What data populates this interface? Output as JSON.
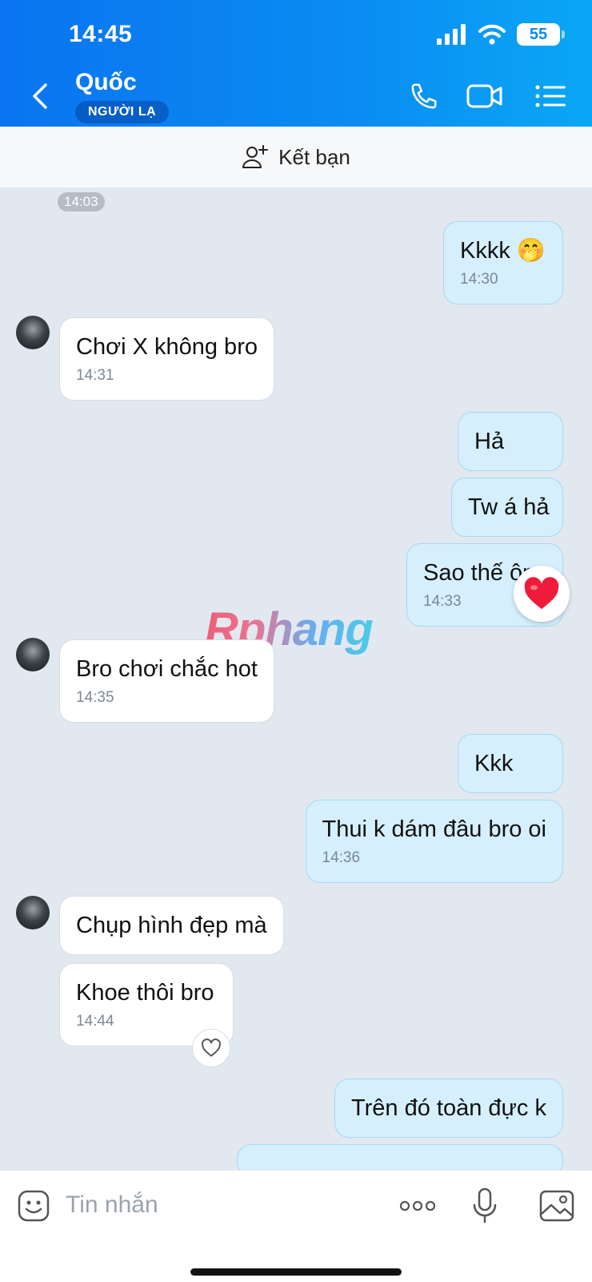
{
  "status_bar": {
    "time": "14:45",
    "battery": "55"
  },
  "header": {
    "contact_name": "Quốc",
    "badge": "NGƯỜI LẠ",
    "icons": [
      "back-icon",
      "phone-icon",
      "video-icon",
      "menu-icon"
    ]
  },
  "friend_bar": {
    "label": "Kết bạn",
    "icon": "add-friend-icon"
  },
  "chat": {
    "top_time": "14:03",
    "messages": [
      {
        "dir": "out",
        "text": "Kkkk 🤭",
        "time": "14:30"
      },
      {
        "dir": "in",
        "text": "Chơi X không bro",
        "time": "14:31"
      },
      {
        "dir": "out",
        "text": "Hả",
        "time": ""
      },
      {
        "dir": "out",
        "text": "Tw á hả",
        "time": ""
      },
      {
        "dir": "out",
        "text": "Sao thế ông",
        "time": "14:33",
        "reaction": "❤️"
      },
      {
        "dir": "in",
        "text": "Bro chơi chắc hot",
        "time": "14:35"
      },
      {
        "dir": "out",
        "text": "Kkk",
        "time": ""
      },
      {
        "dir": "out",
        "text": "Thui k dám đâu bro oi",
        "time": "14:36"
      },
      {
        "dir": "in",
        "text": "Chụp hình đẹp mà",
        "time": ""
      },
      {
        "dir": "in",
        "text": "Khoe thôi bro",
        "time": "14:44",
        "reaction": "heart-outline"
      },
      {
        "dir": "out",
        "text": "Trên đó toàn đực k",
        "time": ""
      }
    ],
    "watermark": "Rphang"
  },
  "composer": {
    "placeholder": "Tin nhắn",
    "icons": [
      "sticker-icon",
      "more-icon",
      "microphone-icon",
      "image-icon"
    ]
  }
}
